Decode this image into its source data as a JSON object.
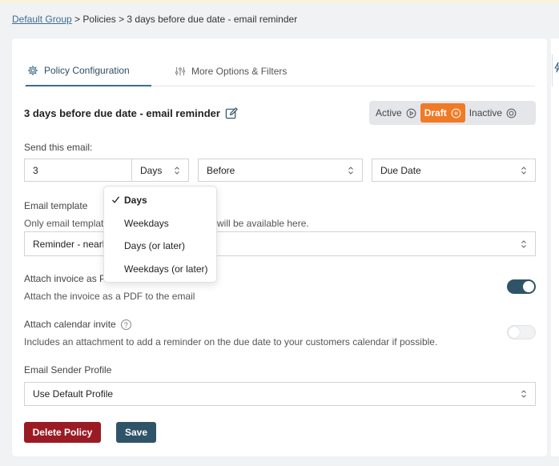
{
  "breadcrumb": {
    "root": "Default Group",
    "rest": " > Policies > 3 days before due date - email reminder"
  },
  "tabs": [
    {
      "label": "Policy Configuration",
      "icon": "gear-icon",
      "active": true
    },
    {
      "label": "More Options & Filters",
      "icon": "sliders-icon",
      "active": false
    }
  ],
  "policy": {
    "title": "3 days before due date - email reminder",
    "edit_icon": "edit-icon"
  },
  "status": {
    "options": [
      {
        "label": "Active",
        "icon": "play-circle-icon"
      },
      {
        "label": "Draft",
        "icon": "pause-circle-icon"
      },
      {
        "label": "Inactive",
        "icon": "stop-circle-icon"
      }
    ],
    "selected": "Draft",
    "accent": "#f07a25"
  },
  "send": {
    "label": "Send this email:",
    "amount": "3",
    "unit": "Days",
    "relation": "Before",
    "reference": "Due Date"
  },
  "unit_menu": {
    "items": [
      "Days",
      "Weekdays",
      "Days (or later)",
      "Weekdays (or later)"
    ],
    "selected": "Days"
  },
  "template": {
    "label": "Email template",
    "help_left": "Only email templat",
    "help_right": "will be available here.",
    "value": "Reminder - nearl"
  },
  "attach_invoice": {
    "label": "Attach invoice as P",
    "help": "Attach the invoice as a PDF to the email",
    "enabled": true
  },
  "attach_calendar": {
    "label": "Attach calendar invite",
    "help": "Includes an attachment to add a reminder on the due date to your customers calendar if possible.",
    "enabled": false,
    "help_glyph": "?"
  },
  "sender": {
    "label": "Email Sender Profile",
    "value": "Use Default Profile"
  },
  "actions": {
    "delete_label": "Delete Policy",
    "save_label": "Save",
    "delete_color": "#9b1b25",
    "save_color": "#2f5468"
  }
}
